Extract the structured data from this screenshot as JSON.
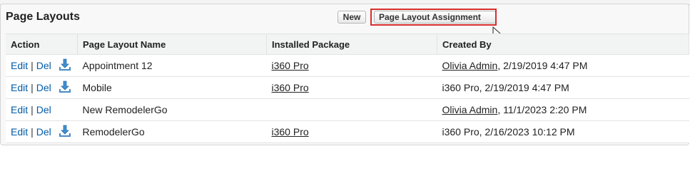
{
  "header": {
    "title": "Page Layouts",
    "new_label": "New",
    "assign_label": "Page Layout Assignment"
  },
  "table": {
    "columns": [
      "Action",
      "Page Layout Name",
      "Installed Package",
      "Created By"
    ],
    "action_edit": "Edit",
    "action_sep": "|",
    "action_del": "Del",
    "rows": [
      {
        "name": "Appointment 12",
        "package": "i360 Pro",
        "created_by_user": "Olivia Admin",
        "created_by_date": ", 2/19/2019 4:47 PM",
        "has_download": true
      },
      {
        "name": "Mobile",
        "package": "i360 Pro",
        "created_by_user": "",
        "created_by_date": "i360 Pro, 2/19/2019 4:47 PM",
        "has_download": true
      },
      {
        "name": "New RemodelerGo",
        "package": "",
        "created_by_user": "Olivia Admin",
        "created_by_date": ", 11/1/2023 2:20 PM",
        "has_download": false
      },
      {
        "name": "RemodelerGo",
        "package": "i360 Pro",
        "created_by_user": "",
        "created_by_date": "i360 Pro, 2/16/2023 10:12 PM",
        "has_download": true
      }
    ]
  },
  "colors": {
    "link_blue": "#015ba7",
    "highlight_red": "#d82e2e"
  },
  "icons": {
    "download": "download-icon",
    "cursor": "mouse-pointer-icon"
  }
}
